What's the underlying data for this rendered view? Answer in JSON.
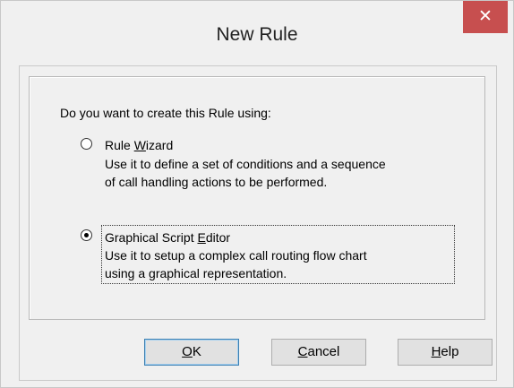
{
  "window": {
    "title": "New Rule",
    "close_icon": "close-icon"
  },
  "content": {
    "question": "Do you want to create this Rule using:",
    "options": [
      {
        "label_pre": "Rule ",
        "label_ul": "W",
        "label_post": "izard",
        "desc1": "Use it to define a set of conditions and a sequence",
        "desc2": "of call handling actions to be performed.",
        "selected": false
      },
      {
        "label_pre": "Graphical Script ",
        "label_ul": "E",
        "label_post": "ditor",
        "desc1": "Use it to setup a complex call routing flow chart",
        "desc2": "using a graphical representation.",
        "selected": true
      }
    ]
  },
  "buttons": {
    "ok_ul": "O",
    "ok_rest": "K",
    "cancel_ul": "C",
    "cancel_rest": "ancel",
    "help_ul": "H",
    "help_rest": "elp"
  },
  "colors": {
    "close_bg": "#c74f4f",
    "dialog_bg": "#f0f0f0",
    "button_bg": "#e1e1e1",
    "default_button_border": "#3c7fb1"
  }
}
